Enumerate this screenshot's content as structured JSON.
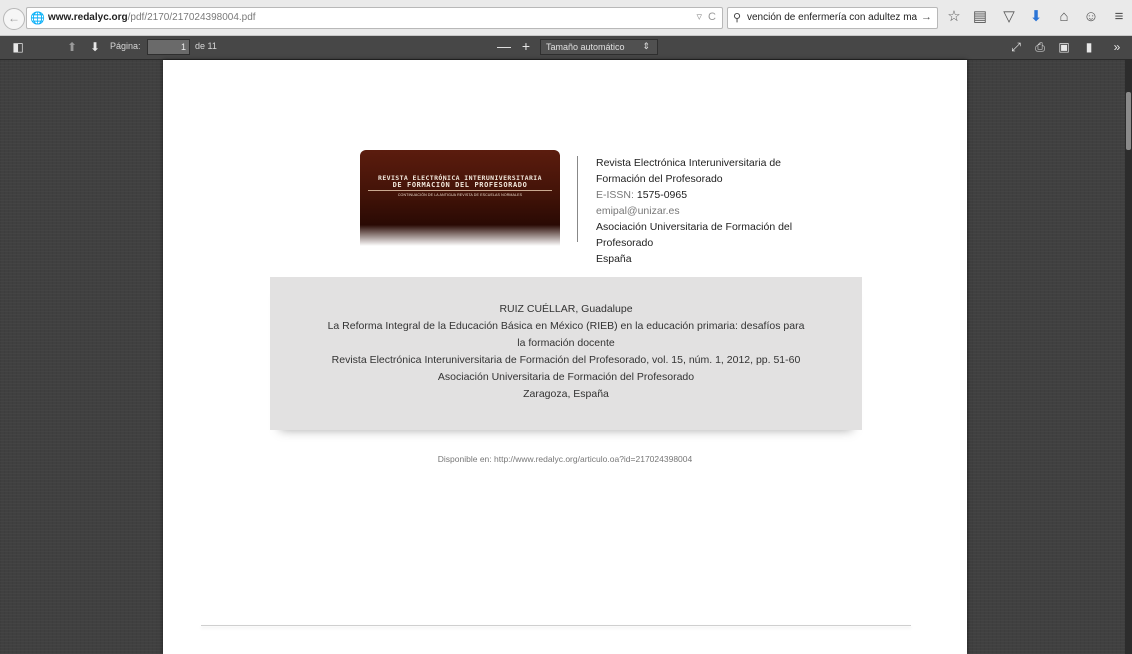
{
  "browser": {
    "url_domain": "www.redalyc.org",
    "url_path": "/pdf/2170/217024398004.pdf",
    "search_query": "vención de enfermería con adultez mayor."
  },
  "toolbar": {
    "page_label": "Página:",
    "page_value": "1",
    "page_total": "de 11",
    "zoom_minus": "—",
    "zoom_plus": "+",
    "zoom_option": "Tamaño automático"
  },
  "document": {
    "logo": {
      "line1": "REVISTA ELECTRÓNICA INTERUNIVERSITARIA",
      "line2": "DE FORMACIÓN DEL PROFESORADO",
      "line3": "CONTINUACIÓN DE LA ANTIGUA REVISTA DE ESCUELAS NORMALES"
    },
    "journal_line1": "Revista Electrónica Interuniversitaria de",
    "journal_line2": "Formación del Profesorado",
    "eissn_label": "E-ISSN:",
    "eissn_value": "1575-0965",
    "email": "emipal@unizar.es",
    "publisher_line1": "Asociación Universitaria de Formación del",
    "publisher_line2": "Profesorado",
    "country": "España",
    "citation": {
      "author": "RUIZ CUÉLLAR, Guadalupe",
      "title_line1": "La Reforma Integral de la Educación Básica en México (RIEB) en la educación primaria: desafíos para",
      "title_line2": "la formación docente",
      "source": "Revista Electrónica Interuniversitaria de Formación del Profesorado, vol. 15, núm. 1, 2012, pp. 51-60",
      "publisher": "Asociación Universitaria de Formación del Profesorado",
      "location": "Zaragoza, España"
    },
    "available_at": "Disponible en: http://www.redalyc.org/articulo.oa?id=217024398004"
  }
}
